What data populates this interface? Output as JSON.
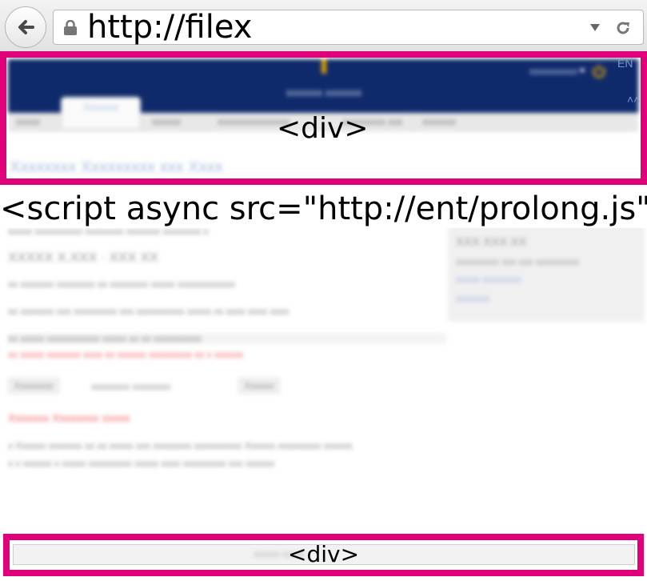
{
  "browser": {
    "url": "http://filex",
    "back_icon": "back-arrow-icon",
    "lock_icon": "lock-icon",
    "dropdown_icon": "dropdown-triangle-icon",
    "reload_icon": "reload-icon"
  },
  "header": {
    "title": "xxxxxxx xxxxxxx",
    "user": "xxxxxxxxxx",
    "language": "EN",
    "power_icon": "power-icon",
    "collapse_icon": "double-chevron-up-icon",
    "background_color": "#0f2a6b",
    "power_color": "#e6a400"
  },
  "tabs": [
    {
      "label": "xxxxx"
    },
    {
      "label": "Xxxxxxx",
      "active": true
    },
    {
      "label": "xxxxxx"
    },
    {
      "label": "xxxxxxxxxxxxxxx"
    },
    {
      "label": "xxxxxxxxx xxx"
    },
    {
      "label": "xxxxxxx"
    }
  ],
  "page_heading": "Xxxxxxxx Xxxxxxxxx xxx Xxxx",
  "main": {
    "lines": [
      "xxxxx xxxxxxxxxx xxxxxxxx xxxxxxx xxxxxxxx x",
      "XXXXX X.XXX · XXX XX",
      "xx xxxxxxx xxxxxxxx xx xxxxxxxx xxxxx xxxxxxxxxxxx",
      "xx xxxxxxx xxx xxxxxxxxx xxx xxxxxxxxxx xxxxx xx xxxx xxxx xxxx",
      "xx xxxxx xxxxxxxxxxx xxxxx xx xx xxxxxxxxxx"
    ],
    "red_note": "xx xxxxx xxxxxxx xxxx xx xxxxxx xxxxxxxxx xx x xxxxxx",
    "button_left": "Xxxxxxxx",
    "button_mid": "xxxxxxxx xxxxxxxx",
    "button_right": "Xxxxxx",
    "red_heading": "Xxxxxxx Xxxxxxxx xxxxx"
  },
  "sidebar": {
    "title": "XXX XXX XX",
    "line1": "xxxxxxxxx xxx xxx xxxxxxxxx",
    "link1": "xxxxx xxxxxxxx",
    "link2": "xxxxxxx"
  },
  "list": [
    "x  Xxxxxx xxxxxxx xx xx xxxxx xxx xxxxxxxx xxxxxxxxxx Xxxxxx xxxxxxxxx xxxxxx",
    "x  x xxxxxx x xxxxx xxxxxxxxx xxxxx xxxx xxxxxxxxx xxx xxxxxx"
  ],
  "annotations": {
    "header_tag": "<div>",
    "script_tag": "<script async src=\"http://ent/prolong.js\">",
    "footer_tag": "<div>",
    "footer_text": "xxxxxx xxxxx",
    "outline_color": "#e0007a"
  }
}
